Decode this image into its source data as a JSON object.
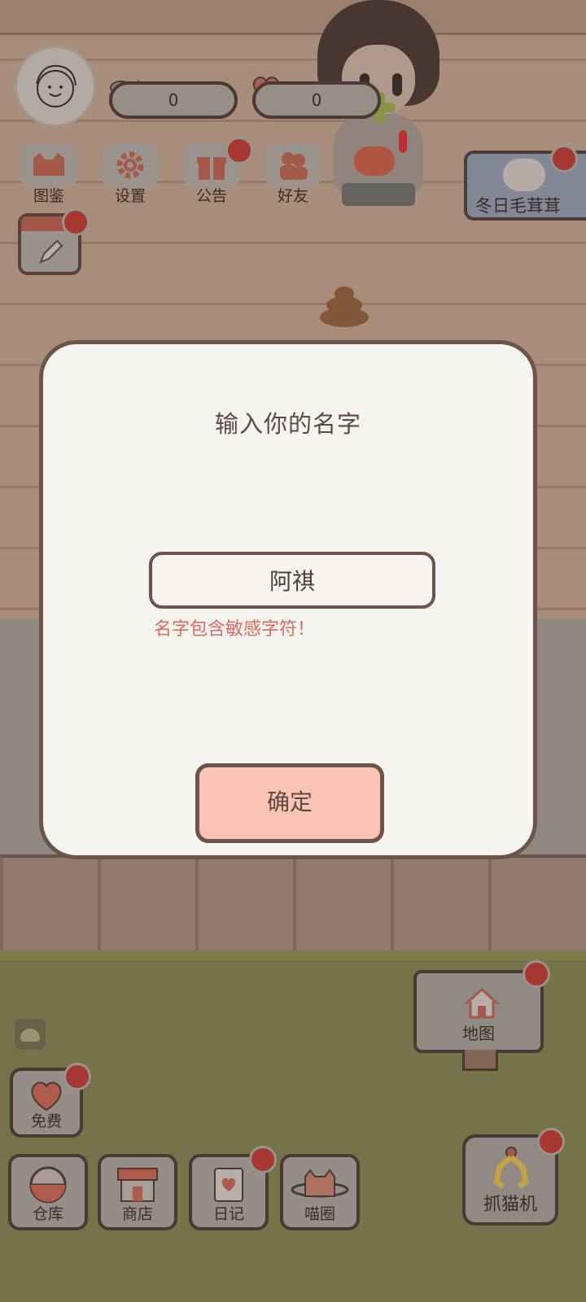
{
  "hud": {
    "fish_count": "0",
    "heart_count": "0"
  },
  "menu": {
    "items": [
      {
        "label": "图鉴",
        "icon": "cat-book-icon"
      },
      {
        "label": "设置",
        "icon": "gear-icon"
      },
      {
        "label": "公告",
        "icon": "gift-icon"
      },
      {
        "label": "好友",
        "icon": "friends-icon"
      }
    ],
    "event_label": "冬日毛茸茸"
  },
  "dialog": {
    "title": "输入你的名字",
    "name_value": "阿祺",
    "error": "名字包含敏感字符！",
    "confirm_label": "确定"
  },
  "bottom": {
    "map_label": "地图",
    "free_label": "免费",
    "storage_label": "仓库",
    "shop_label": "商店",
    "diary_label": "日记",
    "circle_label": "喵圈",
    "claw_label": "抓猫机"
  },
  "colors": {
    "accent": "#f9c4b6",
    "error": "#e06a5a",
    "badge": "#b53a34",
    "outline": "#6d5449"
  }
}
